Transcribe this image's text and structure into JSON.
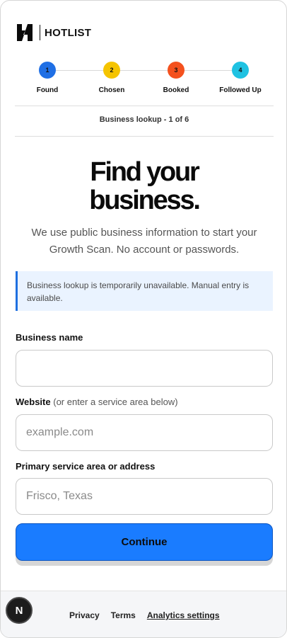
{
  "brand": {
    "name": "HOTLIST",
    "logo_icon": "hotlist-h-logo-icon"
  },
  "stepper": {
    "steps": [
      {
        "number": "1",
        "label": "Found",
        "color": "#1f6fe5"
      },
      {
        "number": "2",
        "label": "Chosen",
        "color": "#f5c400"
      },
      {
        "number": "3",
        "label": "Booked",
        "color": "#f4511e"
      },
      {
        "number": "4",
        "label": "Followed Up",
        "color": "#1fc2e2"
      }
    ]
  },
  "lookup": {
    "progress_text": "Business lookup - 1 of 6"
  },
  "hero": {
    "headline_line1": "Find your",
    "headline_line2": "business.",
    "subtext": "We use public business information to start your Growth Scan. No account or passwords."
  },
  "notice": {
    "text": "Business lookup is temporarily unavailable. Manual entry is available.",
    "accent_color": "#1e6fe0"
  },
  "form": {
    "business_name": {
      "label": "Business name",
      "value": "",
      "placeholder": ""
    },
    "website": {
      "label": "Website",
      "hint": "(or enter a service area below)",
      "value": "",
      "placeholder": "example.com"
    },
    "service_area": {
      "label": "Primary service area or address",
      "value": "",
      "placeholder": "Frisco, Texas"
    },
    "continue_label": "Continue",
    "continue_color": "#1a7cff"
  },
  "footer": {
    "privacy": "Privacy",
    "terms": "Terms",
    "analytics": "Analytics settings"
  },
  "dev_badge": {
    "letter": "N"
  }
}
